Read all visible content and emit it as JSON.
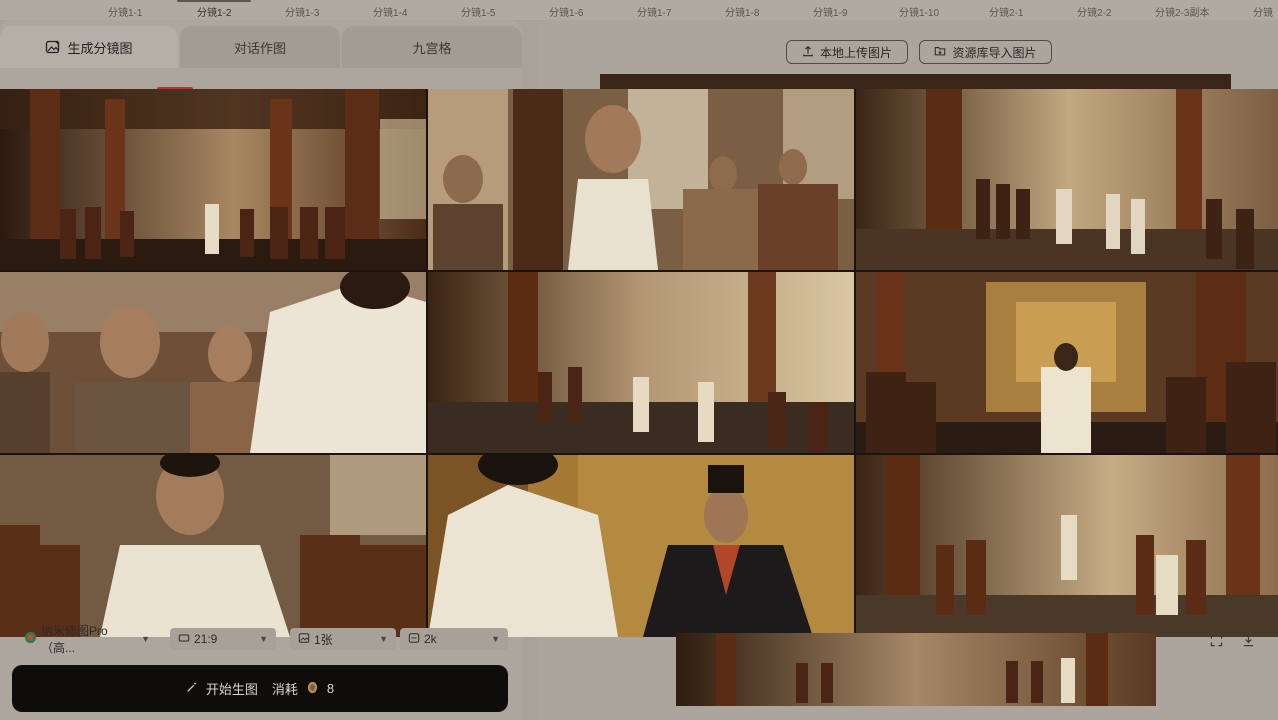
{
  "shots": [
    "分镜1-1",
    "分镜1-2",
    "分镜1-3",
    "分镜1-4",
    "分镜1-5",
    "分镜1-6",
    "分镜1-7",
    "分镜1-8",
    "分镜1-9",
    "分镜1-10",
    "分镜2-1",
    "分镜2-2",
    "分镜2-3副本",
    "分镜"
  ],
  "active_shot_index": 1,
  "mode_tabs": [
    {
      "label": "生成分镜图",
      "icon": "image-sparkle-icon",
      "active": true
    },
    {
      "label": "对话作图",
      "active": false
    },
    {
      "label": "九宫格",
      "active": false
    }
  ],
  "right_header": {
    "upload_local": "本地上传图片",
    "import_library": "资源库导入图片"
  },
  "settings": {
    "model": "纳米修图Pro（高...",
    "ratio": "21:9",
    "count": "1张",
    "resolution": "2k"
  },
  "generate": {
    "label": "开始生图",
    "cost_label": "消耗",
    "cost_value": "8"
  },
  "colors": {
    "overlay": "#a7a29c",
    "button_dark": "#0e0d0c"
  }
}
